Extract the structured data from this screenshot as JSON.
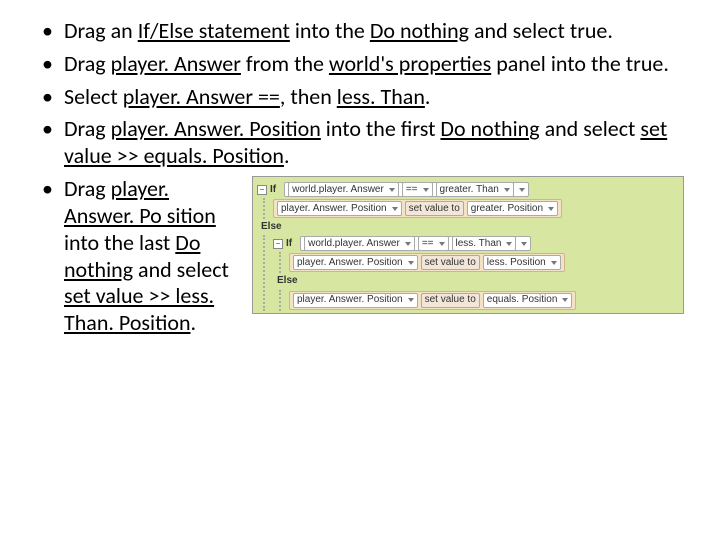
{
  "bullets": {
    "b1": {
      "pre": "Drag an ",
      "u1": "If/Else statement",
      "mid": " into the ",
      "u2": "Do nothing",
      "post": " and select true."
    },
    "b2": {
      "pre": "Drag ",
      "u1": "player. Answer",
      "mid": " from the ",
      "u2": "world's properties",
      "post": " panel into the true."
    },
    "b3": {
      "pre": "Select ",
      "u1": "player. Answer ==",
      "mid": ", then ",
      "u2": "less. Than",
      "post": "."
    },
    "b4": {
      "pre": "Drag ",
      "u1": "player. Answer. Position",
      "mid": " into the first ",
      "u2": "Do nothing",
      "post1": " and select ",
      "u3": "set value >> equals. Position",
      "post2": "."
    },
    "b5": {
      "pre": "Drag ",
      "u1": "player. Answer. Po sition",
      "mid": " into the last ",
      "u2": "Do nothing",
      "post1": " and select ",
      "u3": "set value >> less. Than. Position",
      "post2": "."
    }
  },
  "code": {
    "minus": "−",
    "if": "If",
    "else": "Else",
    "world_answer": "world.player. Answer",
    "eq": "==",
    "gt": "greater. Than",
    "lt": "less. Than",
    "pos": "player. Answer. Position",
    "setv": "set value to",
    "gtpos": "greater. Position",
    "ltpos": "less. Position",
    "eqpos": "equals. Position"
  }
}
